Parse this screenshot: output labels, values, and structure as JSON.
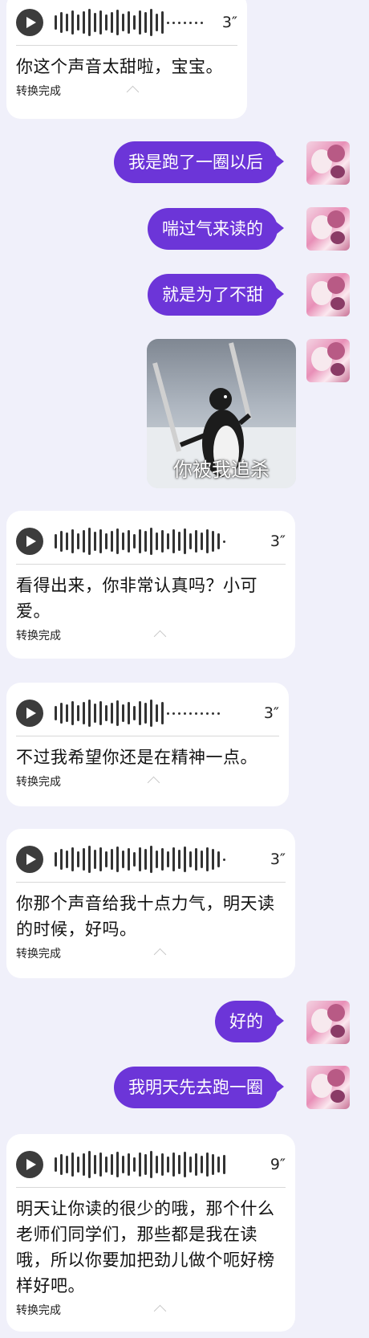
{
  "messages": {
    "v1": {
      "duration": "3″",
      "transcript": "你这个声音太甜啦，宝宝。",
      "status": "转换完成"
    },
    "s1": {
      "text": "我是跑了一圈以后"
    },
    "s2": {
      "text": "喘过气来读的"
    },
    "s3": {
      "text": "就是为了不甜"
    },
    "sticker": {
      "caption": "你被我追杀"
    },
    "v2": {
      "duration": "3″",
      "transcript": "看得出来，你非常认真吗？小可爱。",
      "status": "转换完成"
    },
    "v3": {
      "duration": "3″",
      "transcript": "不过我希望你还是在精神一点。",
      "status": "转换完成"
    },
    "v4": {
      "duration": "3″",
      "transcript": "你那个声音给我十点力气，明天读的时候，好吗。",
      "status": "转换完成"
    },
    "s4": {
      "text": "好的"
    },
    "s5": {
      "text": "我明天先去跑一圈"
    },
    "v5": {
      "duration": "9″",
      "transcript": "明天让你读的很少的哦，那个什么老师们同学们，那些都是我在读哦，所以你要加把劲儿做个呃好榜样好吧。",
      "status": "转换完成"
    }
  },
  "colors": {
    "background": "#f0f0fa",
    "sent_bubble": "#6c35d8",
    "received_bubble": "#ffffff"
  },
  "icons": {
    "play": "play-icon",
    "waveform": "voice-waveform-icon",
    "collapse": "chevron-up-icon"
  }
}
